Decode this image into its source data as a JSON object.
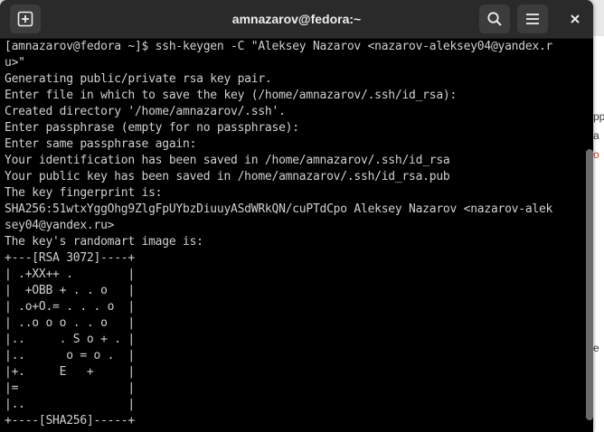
{
  "window": {
    "title": "amnazarov@fedora:~",
    "new_tab_icon": "new-tab-icon",
    "search_icon": "search-icon",
    "menu_icon": "hamburger-menu-icon",
    "close_icon": "close-icon"
  },
  "terminal": {
    "lines": [
      "[amnazarov@fedora ~]$ ssh-keygen -C \"Aleksey Nazarov <nazarov-aleksey04@yandex.r",
      "u>\"",
      "Generating public/private rsa key pair.",
      "Enter file in which to save the key (/home/amnazarov/.ssh/id_rsa):",
      "Created directory '/home/amnazarov/.ssh'.",
      "Enter passphrase (empty for no passphrase):",
      "Enter same passphrase again:",
      "Your identification has been saved in /home/amnazarov/.ssh/id_rsa",
      "Your public key has been saved in /home/amnazarov/.ssh/id_rsa.pub",
      "The key fingerprint is:",
      "SHA256:51wtxYggOhg9ZlgFpUYbzDiuuyASdWRkQN/cuPTdCpo Aleksey Nazarov <nazarov-alek",
      "sey04@yandex.ru>",
      "The key's randomart image is:",
      "+---[RSA 3072]----+",
      "| .+XX++ .        |",
      "|  +OBB + . . o   |",
      "| .o+O.= . . . o  |",
      "| ..o o o . . o   |",
      "|..     . S o + . |",
      "|..      o = o .  |",
      "|+.     E   +     |",
      "|=                |",
      "|..               |",
      "+----[SHA256]-----+"
    ]
  },
  "background_fragments": [
    {
      "text": "pp",
      "color": "#333333"
    },
    {
      "text": "a",
      "color": "#333333"
    },
    {
      "text": "o",
      "color": "#c0392b"
    },
    {
      "text": "e",
      "color": "#333333"
    }
  ]
}
